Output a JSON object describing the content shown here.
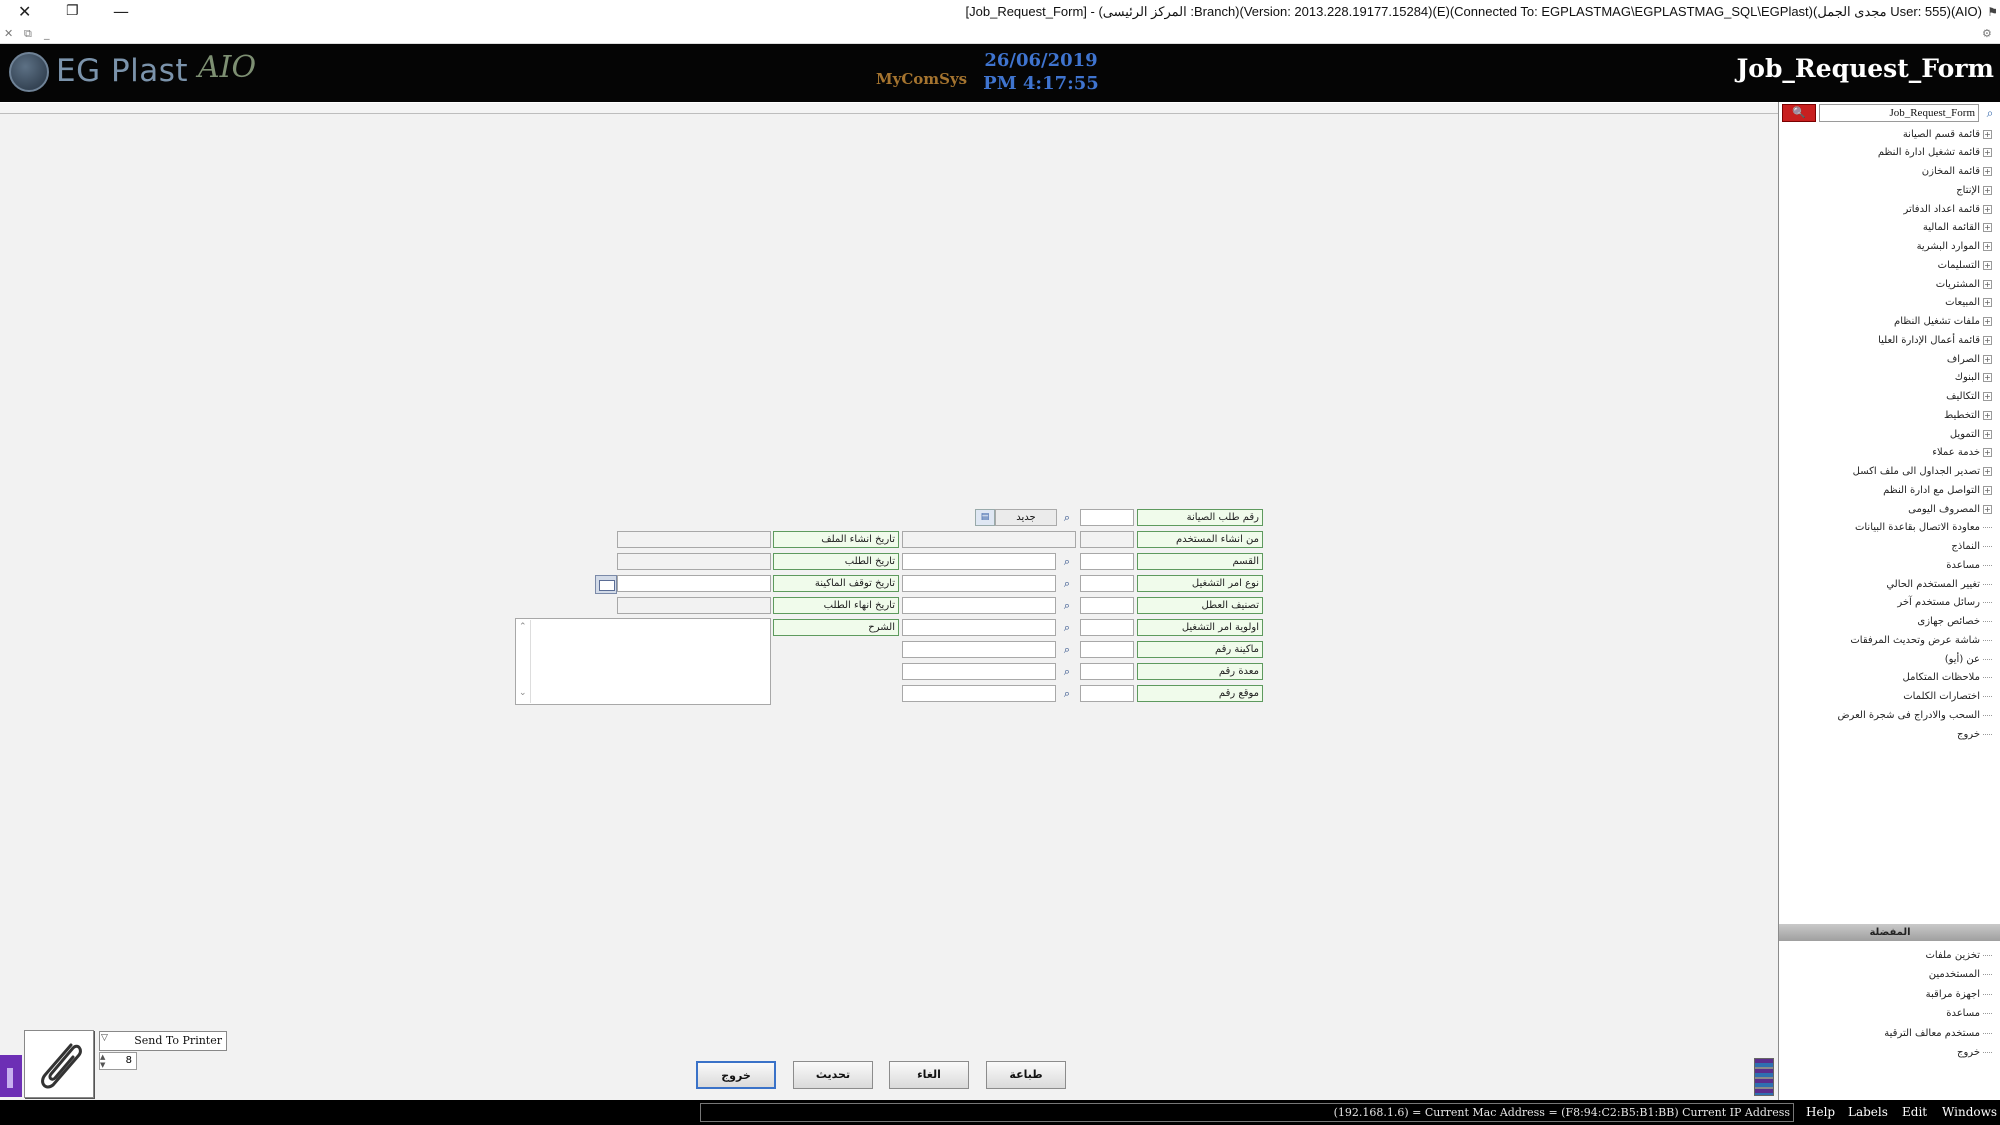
{
  "window": {
    "title": "[Job_Request_Form] - (المركز الرئيسى :Branch)(Version: 2013.228.19177.15284)(E)(Connected To: EGPLASTMAG\\EGPLASTMAG_SQL\\EGPlast)(مجدى الجمل User: 555)(AIO)"
  },
  "header": {
    "logo_text": "EG Plast",
    "logo_suffix": "AIO",
    "vendor": "MyComSys",
    "date": "26/06/2019",
    "time": "PM 4:17:55",
    "form_title": "Job_Request_Form"
  },
  "sidebar": {
    "search_value": "Job_Request_Form",
    "items": [
      {
        "label": "قائمة قسم الصيانة",
        "expandable": true
      },
      {
        "label": "قائمة تشغيل ادارة النظم",
        "expandable": true
      },
      {
        "label": "قائمة المخازن",
        "expandable": true
      },
      {
        "label": "الإنتاج",
        "expandable": true
      },
      {
        "label": "قائمة اعداد الدفاتر",
        "expandable": true
      },
      {
        "label": "القائمة المالية",
        "expandable": true
      },
      {
        "label": "الموارد البشرية",
        "expandable": true
      },
      {
        "label": "التسليمات",
        "expandable": true
      },
      {
        "label": "المشتريات",
        "expandable": true
      },
      {
        "label": "المبيعات",
        "expandable": true
      },
      {
        "label": "ملفات تشغيل النظام",
        "expandable": true
      },
      {
        "label": "قائمة أعمال الإدارة العليا",
        "expandable": true
      },
      {
        "label": "الصراف",
        "expandable": true
      },
      {
        "label": "البنوك",
        "expandable": true
      },
      {
        "label": "التكاليف",
        "expandable": true
      },
      {
        "label": "التخطيط",
        "expandable": true
      },
      {
        "label": "التمويل",
        "expandable": true
      },
      {
        "label": "خدمة عملاء",
        "expandable": true
      },
      {
        "label": "تصدير الجداول الى ملف اكسل",
        "expandable": true
      },
      {
        "label": "التواصل مع ادارة النظم",
        "expandable": true
      },
      {
        "label": "المصروف اليومى",
        "expandable": true
      },
      {
        "label": "معاودة الاتصال بقاعدة البيانات",
        "expandable": false
      },
      {
        "label": "النماذج",
        "expandable": false
      },
      {
        "label": "مساعدة",
        "expandable": false
      },
      {
        "label": "تغيير المستخدم الحالي",
        "expandable": false
      },
      {
        "label": "رسائل مستخدم آخر",
        "expandable": false
      },
      {
        "label": "خصائص جهازى",
        "expandable": false
      },
      {
        "label": "شاشة عرض وتحديث المرفقات",
        "expandable": false
      },
      {
        "label": "عن (أيو)",
        "expandable": false
      },
      {
        "label": "ملاحظات المتكامل",
        "expandable": false
      },
      {
        "label": "اختصارات الكلمات",
        "expandable": false
      },
      {
        "label": "السحب والادراج فى شجرة العرض",
        "expandable": false
      },
      {
        "label": "خروج",
        "expandable": false
      }
    ],
    "favorites_title": "المفضلة",
    "favorites": [
      "تخزين ملفات",
      "المستخدمين",
      "اجهزة مراقبة",
      "مساعدة",
      "مستخدم معالف الترقية",
      "خروج"
    ]
  },
  "form": {
    "labels": {
      "request_no": "رقم طلب الصيانة",
      "created_by": "من انشاء المستخدم",
      "department": "القسم",
      "order_type": "نوع امر التشغيل",
      "fault_class": "تصنيف العطل",
      "priority": "اولوية امر التشغيل",
      "machine_no": "ماكينة رقم",
      "equipment_no": "معدة رقم",
      "location_no": "موقع رقم",
      "file_created_date": "تاريخ انشاء الملف",
      "request_date": "تاريخ الطلب",
      "machine_stop_date": "تاريخ توقف الماكينة",
      "request_end_date": "تاريخ انهاء الطلب",
      "description": "الشرح"
    },
    "new_button": "جديد",
    "values": {
      "request_no": "",
      "created_by": "",
      "department": "",
      "order_type": "",
      "fault_class": "",
      "priority": "",
      "machine_no": "",
      "equipment_no": "",
      "location_no": "",
      "file_created_date": "",
      "request_date": "",
      "machine_stop_date": "",
      "request_end_date": "",
      "description": ""
    }
  },
  "actions": {
    "exit": "خروج",
    "update": "تحديث",
    "cancel": "الغاء",
    "print": "طباعة"
  },
  "printer": {
    "selected": "Send To Printer",
    "copies": "8"
  },
  "statusbar": {
    "info": "(192.168.1.6) = Current Mac Address = (F8:94:C2:B5:B1:BB) Current IP Address",
    "menus": [
      "Help",
      "Labels",
      "Edit",
      "Windows"
    ]
  }
}
